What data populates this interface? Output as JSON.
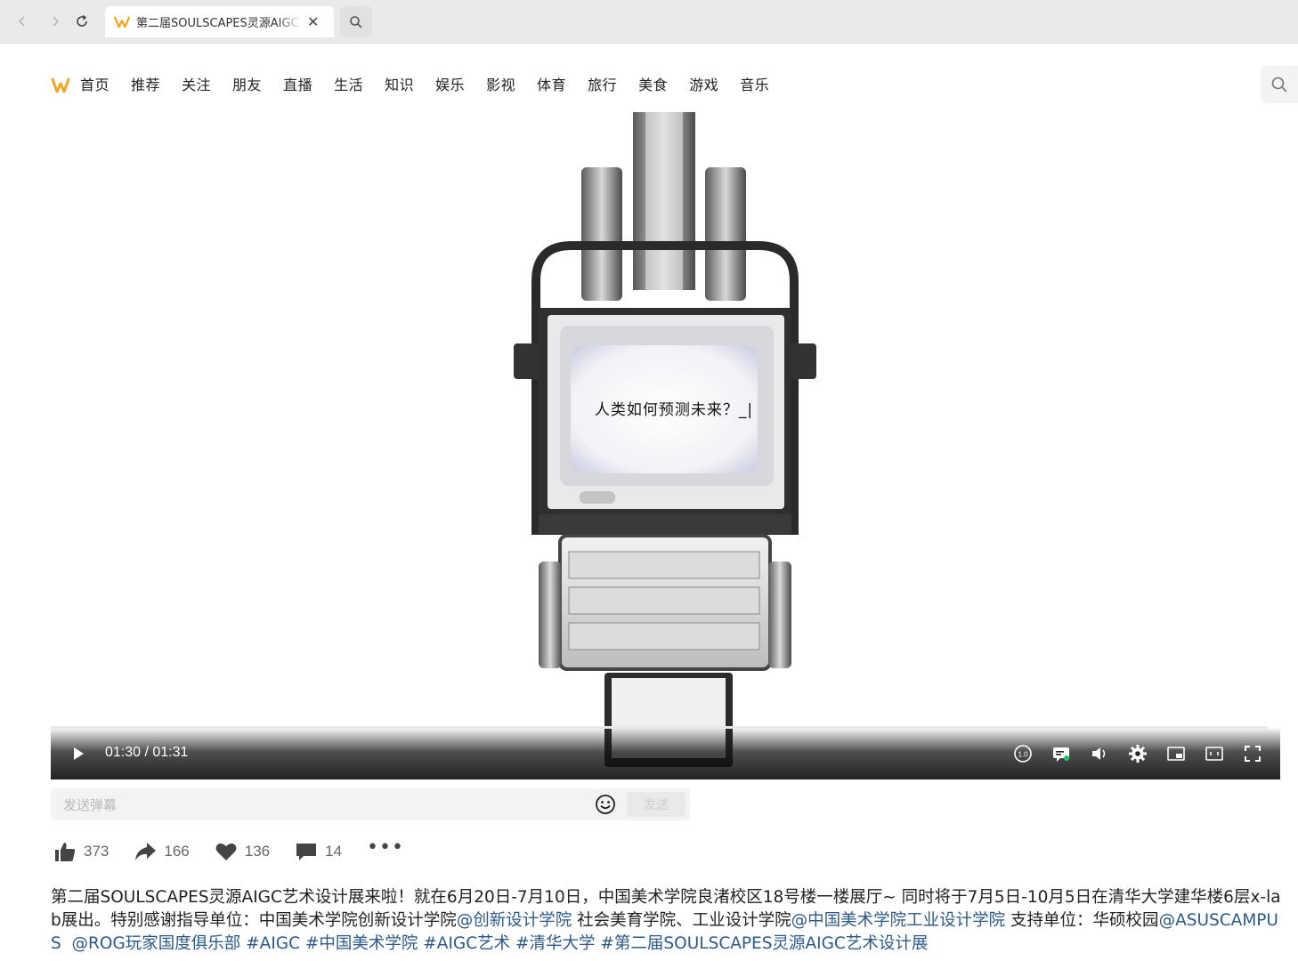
{
  "browser": {
    "tab_title": "第二届SOULSCAPES灵源AIGC艺术设计展来啦",
    "accent": "#f2a623"
  },
  "site": {
    "nav": [
      "首页",
      "推荐",
      "关注",
      "朋友",
      "直播",
      "生活",
      "知识",
      "娱乐",
      "影视",
      "体育",
      "旅行",
      "美食",
      "游戏",
      "音乐"
    ]
  },
  "video": {
    "screen_text": "人类如何预测未来？_|",
    "time": "01:30 / 01:31",
    "progress": 0.99
  },
  "danmaku": {
    "placeholder": "发送弹幕",
    "send_label": "发送"
  },
  "actions": {
    "likes": "373",
    "shares": "166",
    "favorites": "136",
    "comments": "14"
  },
  "description": {
    "text_1": "第二届SOULSCAPES灵源AIGC艺术设计展来啦！就在6月20日-7月10日，中国美术学院良渚校区18号楼一楼展厅~ 同时将于7月5日-10月5日在清华大学建华楼6层x-lab展出。特别感谢指导单位：中国美术学院创新设计学院",
    "mention_1": "@创新设计学院",
    "text_2": " 社会美育学院、工业设计学院",
    "mention_2": "@中国美术学院工业设计学院",
    "text_3": " 支持单位：华硕校园",
    "mention_3": "@ASUSCAMPUS",
    "text_4": "  ",
    "mention_4": "@ROG玩家国度俱乐部",
    "tags": " #AIGC #中国美术学院 #AIGC艺术 #清华大学 #第二届SOULSCAPES灵源AIGC艺术设计展"
  }
}
